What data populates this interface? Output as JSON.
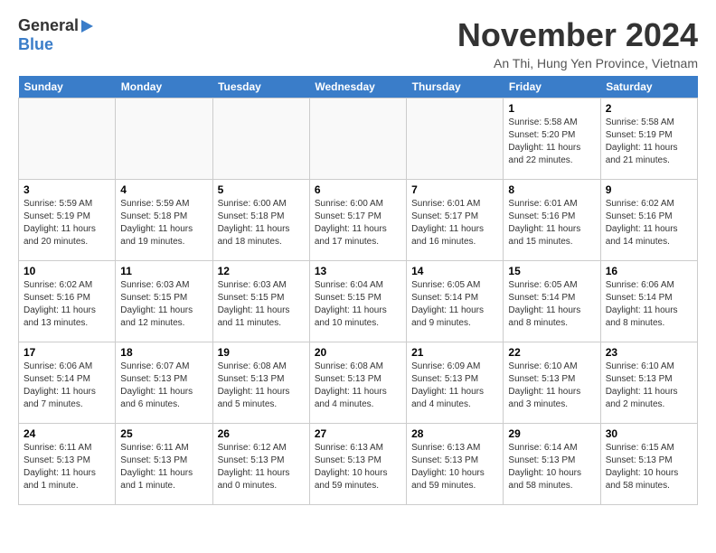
{
  "header": {
    "logo_line1": "General",
    "logo_line2": "Blue",
    "month": "November 2024",
    "location": "An Thi, Hung Yen Province, Vietnam"
  },
  "days_of_week": [
    "Sunday",
    "Monday",
    "Tuesday",
    "Wednesday",
    "Thursday",
    "Friday",
    "Saturday"
  ],
  "weeks": [
    [
      {
        "day": "",
        "info": ""
      },
      {
        "day": "",
        "info": ""
      },
      {
        "day": "",
        "info": ""
      },
      {
        "day": "",
        "info": ""
      },
      {
        "day": "",
        "info": ""
      },
      {
        "day": "1",
        "info": "Sunrise: 5:58 AM\nSunset: 5:20 PM\nDaylight: 11 hours\nand 22 minutes."
      },
      {
        "day": "2",
        "info": "Sunrise: 5:58 AM\nSunset: 5:19 PM\nDaylight: 11 hours\nand 21 minutes."
      }
    ],
    [
      {
        "day": "3",
        "info": "Sunrise: 5:59 AM\nSunset: 5:19 PM\nDaylight: 11 hours\nand 20 minutes."
      },
      {
        "day": "4",
        "info": "Sunrise: 5:59 AM\nSunset: 5:18 PM\nDaylight: 11 hours\nand 19 minutes."
      },
      {
        "day": "5",
        "info": "Sunrise: 6:00 AM\nSunset: 5:18 PM\nDaylight: 11 hours\nand 18 minutes."
      },
      {
        "day": "6",
        "info": "Sunrise: 6:00 AM\nSunset: 5:17 PM\nDaylight: 11 hours\nand 17 minutes."
      },
      {
        "day": "7",
        "info": "Sunrise: 6:01 AM\nSunset: 5:17 PM\nDaylight: 11 hours\nand 16 minutes."
      },
      {
        "day": "8",
        "info": "Sunrise: 6:01 AM\nSunset: 5:16 PM\nDaylight: 11 hours\nand 15 minutes."
      },
      {
        "day": "9",
        "info": "Sunrise: 6:02 AM\nSunset: 5:16 PM\nDaylight: 11 hours\nand 14 minutes."
      }
    ],
    [
      {
        "day": "10",
        "info": "Sunrise: 6:02 AM\nSunset: 5:16 PM\nDaylight: 11 hours\nand 13 minutes."
      },
      {
        "day": "11",
        "info": "Sunrise: 6:03 AM\nSunset: 5:15 PM\nDaylight: 11 hours\nand 12 minutes."
      },
      {
        "day": "12",
        "info": "Sunrise: 6:03 AM\nSunset: 5:15 PM\nDaylight: 11 hours\nand 11 minutes."
      },
      {
        "day": "13",
        "info": "Sunrise: 6:04 AM\nSunset: 5:15 PM\nDaylight: 11 hours\nand 10 minutes."
      },
      {
        "day": "14",
        "info": "Sunrise: 6:05 AM\nSunset: 5:14 PM\nDaylight: 11 hours\nand 9 minutes."
      },
      {
        "day": "15",
        "info": "Sunrise: 6:05 AM\nSunset: 5:14 PM\nDaylight: 11 hours\nand 8 minutes."
      },
      {
        "day": "16",
        "info": "Sunrise: 6:06 AM\nSunset: 5:14 PM\nDaylight: 11 hours\nand 8 minutes."
      }
    ],
    [
      {
        "day": "17",
        "info": "Sunrise: 6:06 AM\nSunset: 5:14 PM\nDaylight: 11 hours\nand 7 minutes."
      },
      {
        "day": "18",
        "info": "Sunrise: 6:07 AM\nSunset: 5:13 PM\nDaylight: 11 hours\nand 6 minutes."
      },
      {
        "day": "19",
        "info": "Sunrise: 6:08 AM\nSunset: 5:13 PM\nDaylight: 11 hours\nand 5 minutes."
      },
      {
        "day": "20",
        "info": "Sunrise: 6:08 AM\nSunset: 5:13 PM\nDaylight: 11 hours\nand 4 minutes."
      },
      {
        "day": "21",
        "info": "Sunrise: 6:09 AM\nSunset: 5:13 PM\nDaylight: 11 hours\nand 4 minutes."
      },
      {
        "day": "22",
        "info": "Sunrise: 6:10 AM\nSunset: 5:13 PM\nDaylight: 11 hours\nand 3 minutes."
      },
      {
        "day": "23",
        "info": "Sunrise: 6:10 AM\nSunset: 5:13 PM\nDaylight: 11 hours\nand 2 minutes."
      }
    ],
    [
      {
        "day": "24",
        "info": "Sunrise: 6:11 AM\nSunset: 5:13 PM\nDaylight: 11 hours\nand 1 minute."
      },
      {
        "day": "25",
        "info": "Sunrise: 6:11 AM\nSunset: 5:13 PM\nDaylight: 11 hours\nand 1 minute."
      },
      {
        "day": "26",
        "info": "Sunrise: 6:12 AM\nSunset: 5:13 PM\nDaylight: 11 hours\nand 0 minutes."
      },
      {
        "day": "27",
        "info": "Sunrise: 6:13 AM\nSunset: 5:13 PM\nDaylight: 10 hours\nand 59 minutes."
      },
      {
        "day": "28",
        "info": "Sunrise: 6:13 AM\nSunset: 5:13 PM\nDaylight: 10 hours\nand 59 minutes."
      },
      {
        "day": "29",
        "info": "Sunrise: 6:14 AM\nSunset: 5:13 PM\nDaylight: 10 hours\nand 58 minutes."
      },
      {
        "day": "30",
        "info": "Sunrise: 6:15 AM\nSunset: 5:13 PM\nDaylight: 10 hours\nand 58 minutes."
      }
    ]
  ]
}
